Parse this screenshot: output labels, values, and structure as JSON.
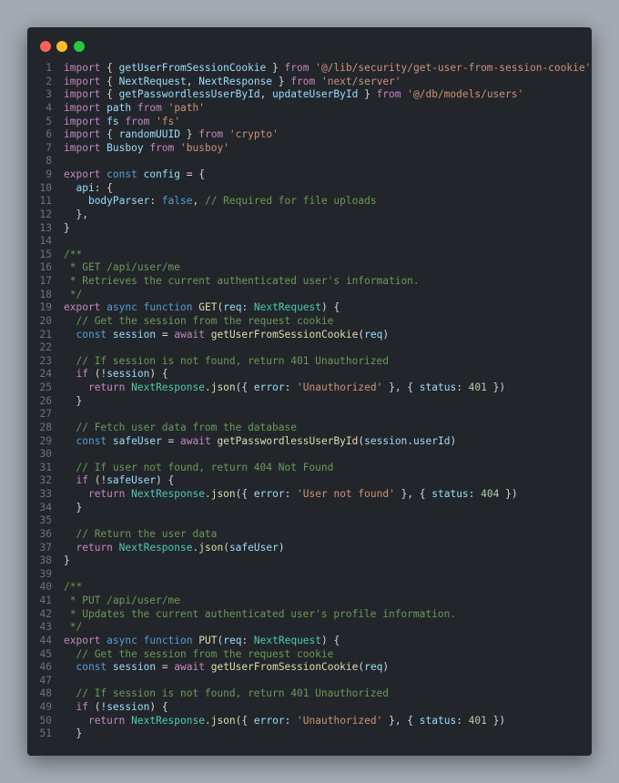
{
  "window": {
    "controls": [
      "close",
      "minimize",
      "zoom"
    ]
  },
  "code": {
    "colors": {
      "keyword": "#569cd6",
      "control": "#c586c0",
      "string": "#ce9178",
      "comment": "#6a9955",
      "function": "#dcdcaa",
      "variable": "#9cdcfe",
      "number": "#b5cea8",
      "type": "#4ec9b0",
      "text": "#d4d4d4"
    },
    "lines": [
      {
        "n": "1",
        "t": [
          [
            "ctl",
            "import"
          ],
          [
            "txt",
            " { "
          ],
          [
            "var",
            "getUserFromSessionCookie"
          ],
          [
            "txt",
            " } "
          ],
          [
            "ctl",
            "from"
          ],
          [
            "txt",
            " "
          ],
          [
            "str",
            "'@/lib/security/get-user-from-session-cookie'"
          ]
        ]
      },
      {
        "n": "2",
        "t": [
          [
            "ctl",
            "import"
          ],
          [
            "txt",
            " { "
          ],
          [
            "var",
            "NextRequest"
          ],
          [
            "txt",
            ", "
          ],
          [
            "var",
            "NextResponse"
          ],
          [
            "txt",
            " } "
          ],
          [
            "ctl",
            "from"
          ],
          [
            "txt",
            " "
          ],
          [
            "str",
            "'next/server'"
          ]
        ]
      },
      {
        "n": "3",
        "t": [
          [
            "ctl",
            "import"
          ],
          [
            "txt",
            " { "
          ],
          [
            "var",
            "getPasswordlessUserById"
          ],
          [
            "txt",
            ", "
          ],
          [
            "var",
            "updateUserById"
          ],
          [
            "txt",
            " } "
          ],
          [
            "ctl",
            "from"
          ],
          [
            "txt",
            " "
          ],
          [
            "str",
            "'@/db/models/users'"
          ]
        ]
      },
      {
        "n": "4",
        "t": [
          [
            "ctl",
            "import"
          ],
          [
            "txt",
            " "
          ],
          [
            "var",
            "path"
          ],
          [
            "txt",
            " "
          ],
          [
            "ctl",
            "from"
          ],
          [
            "txt",
            " "
          ],
          [
            "str",
            "'path'"
          ]
        ]
      },
      {
        "n": "5",
        "t": [
          [
            "ctl",
            "import"
          ],
          [
            "txt",
            " "
          ],
          [
            "var",
            "fs"
          ],
          [
            "txt",
            " "
          ],
          [
            "ctl",
            "from"
          ],
          [
            "txt",
            " "
          ],
          [
            "str",
            "'fs'"
          ]
        ]
      },
      {
        "n": "6",
        "t": [
          [
            "ctl",
            "import"
          ],
          [
            "txt",
            " { "
          ],
          [
            "var",
            "randomUUID"
          ],
          [
            "txt",
            " } "
          ],
          [
            "ctl",
            "from"
          ],
          [
            "txt",
            " "
          ],
          [
            "str",
            "'crypto'"
          ]
        ]
      },
      {
        "n": "7",
        "t": [
          [
            "ctl",
            "import"
          ],
          [
            "txt",
            " "
          ],
          [
            "var",
            "Busboy"
          ],
          [
            "txt",
            " "
          ],
          [
            "ctl",
            "from"
          ],
          [
            "txt",
            " "
          ],
          [
            "str",
            "'busboy'"
          ]
        ]
      },
      {
        "n": "8",
        "t": []
      },
      {
        "n": "9",
        "t": [
          [
            "ctl",
            "export"
          ],
          [
            "txt",
            " "
          ],
          [
            "kw",
            "const"
          ],
          [
            "txt",
            " "
          ],
          [
            "var",
            "config"
          ],
          [
            "txt",
            " = {"
          ]
        ]
      },
      {
        "n": "10",
        "t": [
          [
            "txt",
            "  "
          ],
          [
            "var",
            "api"
          ],
          [
            "txt",
            ": {"
          ]
        ]
      },
      {
        "n": "11",
        "t": [
          [
            "txt",
            "    "
          ],
          [
            "var",
            "bodyParser"
          ],
          [
            "txt",
            ": "
          ],
          [
            "kw",
            "false"
          ],
          [
            "txt",
            ", "
          ],
          [
            "com",
            "// Required for file uploads"
          ]
        ]
      },
      {
        "n": "12",
        "t": [
          [
            "txt",
            "  },"
          ]
        ]
      },
      {
        "n": "13",
        "t": [
          [
            "txt",
            "}"
          ]
        ]
      },
      {
        "n": "14",
        "t": []
      },
      {
        "n": "15",
        "t": [
          [
            "com",
            "/**"
          ]
        ]
      },
      {
        "n": "16",
        "t": [
          [
            "com",
            " * GET /api/user/me"
          ]
        ]
      },
      {
        "n": "17",
        "t": [
          [
            "com",
            " * Retrieves the current authenticated user's information."
          ]
        ]
      },
      {
        "n": "18",
        "t": [
          [
            "com",
            " */"
          ]
        ]
      },
      {
        "n": "19",
        "t": [
          [
            "ctl",
            "export"
          ],
          [
            "txt",
            " "
          ],
          [
            "kw",
            "async"
          ],
          [
            "txt",
            " "
          ],
          [
            "kw",
            "function"
          ],
          [
            "txt",
            " "
          ],
          [
            "fn",
            "GET"
          ],
          [
            "txt",
            "("
          ],
          [
            "var",
            "req"
          ],
          [
            "txt",
            ": "
          ],
          [
            "typ",
            "NextRequest"
          ],
          [
            "txt",
            ") {"
          ]
        ]
      },
      {
        "n": "20",
        "t": [
          [
            "txt",
            "  "
          ],
          [
            "com",
            "// Get the session from the request cookie"
          ]
        ]
      },
      {
        "n": "21",
        "t": [
          [
            "txt",
            "  "
          ],
          [
            "kw",
            "const"
          ],
          [
            "txt",
            " "
          ],
          [
            "var",
            "session"
          ],
          [
            "txt",
            " = "
          ],
          [
            "ctl",
            "await"
          ],
          [
            "txt",
            " "
          ],
          [
            "fn",
            "getUserFromSessionCookie"
          ],
          [
            "txt",
            "("
          ],
          [
            "var",
            "req"
          ],
          [
            "txt",
            ")"
          ]
        ]
      },
      {
        "n": "22",
        "t": []
      },
      {
        "n": "23",
        "t": [
          [
            "txt",
            "  "
          ],
          [
            "com",
            "// If session is not found, return 401 Unauthorized"
          ]
        ]
      },
      {
        "n": "24",
        "t": [
          [
            "txt",
            "  "
          ],
          [
            "ctl",
            "if"
          ],
          [
            "txt",
            " (!"
          ],
          [
            "var",
            "session"
          ],
          [
            "txt",
            ") {"
          ]
        ]
      },
      {
        "n": "25",
        "t": [
          [
            "txt",
            "    "
          ],
          [
            "ctl",
            "return"
          ],
          [
            "txt",
            " "
          ],
          [
            "typ",
            "NextResponse"
          ],
          [
            "txt",
            "."
          ],
          [
            "fn",
            "json"
          ],
          [
            "txt",
            "({ "
          ],
          [
            "var",
            "error"
          ],
          [
            "txt",
            ": "
          ],
          [
            "str",
            "'Unauthorized'"
          ],
          [
            "txt",
            " }, { "
          ],
          [
            "var",
            "status"
          ],
          [
            "txt",
            ": "
          ],
          [
            "num",
            "401"
          ],
          [
            "txt",
            " })"
          ]
        ]
      },
      {
        "n": "26",
        "t": [
          [
            "txt",
            "  }"
          ]
        ]
      },
      {
        "n": "27",
        "t": []
      },
      {
        "n": "28",
        "t": [
          [
            "txt",
            "  "
          ],
          [
            "com",
            "// Fetch user data from the database"
          ]
        ]
      },
      {
        "n": "29",
        "t": [
          [
            "txt",
            "  "
          ],
          [
            "kw",
            "const"
          ],
          [
            "txt",
            " "
          ],
          [
            "var",
            "safeUser"
          ],
          [
            "txt",
            " = "
          ],
          [
            "ctl",
            "await"
          ],
          [
            "txt",
            " "
          ],
          [
            "fn",
            "getPasswordlessUserById"
          ],
          [
            "txt",
            "("
          ],
          [
            "var",
            "session"
          ],
          [
            "txt",
            "."
          ],
          [
            "var",
            "userId"
          ],
          [
            "txt",
            ")"
          ]
        ]
      },
      {
        "n": "30",
        "t": []
      },
      {
        "n": "31",
        "t": [
          [
            "txt",
            "  "
          ],
          [
            "com",
            "// If user not found, return 404 Not Found"
          ]
        ]
      },
      {
        "n": "32",
        "t": [
          [
            "txt",
            "  "
          ],
          [
            "ctl",
            "if"
          ],
          [
            "txt",
            " (!"
          ],
          [
            "var",
            "safeUser"
          ],
          [
            "txt",
            ") {"
          ]
        ]
      },
      {
        "n": "33",
        "t": [
          [
            "txt",
            "    "
          ],
          [
            "ctl",
            "return"
          ],
          [
            "txt",
            " "
          ],
          [
            "typ",
            "NextResponse"
          ],
          [
            "txt",
            "."
          ],
          [
            "fn",
            "json"
          ],
          [
            "txt",
            "({ "
          ],
          [
            "var",
            "error"
          ],
          [
            "txt",
            ": "
          ],
          [
            "str",
            "'User not found'"
          ],
          [
            "txt",
            " }, { "
          ],
          [
            "var",
            "status"
          ],
          [
            "txt",
            ": "
          ],
          [
            "num",
            "404"
          ],
          [
            "txt",
            " })"
          ]
        ]
      },
      {
        "n": "34",
        "t": [
          [
            "txt",
            "  }"
          ]
        ]
      },
      {
        "n": "35",
        "t": []
      },
      {
        "n": "36",
        "t": [
          [
            "txt",
            "  "
          ],
          [
            "com",
            "// Return the user data"
          ]
        ]
      },
      {
        "n": "37",
        "t": [
          [
            "txt",
            "  "
          ],
          [
            "ctl",
            "return"
          ],
          [
            "txt",
            " "
          ],
          [
            "typ",
            "NextResponse"
          ],
          [
            "txt",
            "."
          ],
          [
            "fn",
            "json"
          ],
          [
            "txt",
            "("
          ],
          [
            "var",
            "safeUser"
          ],
          [
            "txt",
            ")"
          ]
        ]
      },
      {
        "n": "38",
        "t": [
          [
            "txt",
            "}"
          ]
        ]
      },
      {
        "n": "39",
        "t": []
      },
      {
        "n": "40",
        "t": [
          [
            "com",
            "/**"
          ]
        ]
      },
      {
        "n": "41",
        "t": [
          [
            "com",
            " * PUT /api/user/me"
          ]
        ]
      },
      {
        "n": "42",
        "t": [
          [
            "com",
            " * Updates the current authenticated user's profile information."
          ]
        ]
      },
      {
        "n": "43",
        "t": [
          [
            "com",
            " */"
          ]
        ]
      },
      {
        "n": "44",
        "t": [
          [
            "ctl",
            "export"
          ],
          [
            "txt",
            " "
          ],
          [
            "kw",
            "async"
          ],
          [
            "txt",
            " "
          ],
          [
            "kw",
            "function"
          ],
          [
            "txt",
            " "
          ],
          [
            "fn",
            "PUT"
          ],
          [
            "txt",
            "("
          ],
          [
            "var",
            "req"
          ],
          [
            "txt",
            ": "
          ],
          [
            "typ",
            "NextRequest"
          ],
          [
            "txt",
            ") {"
          ]
        ]
      },
      {
        "n": "45",
        "t": [
          [
            "txt",
            "  "
          ],
          [
            "com",
            "// Get the session from the request cookie"
          ]
        ]
      },
      {
        "n": "46",
        "t": [
          [
            "txt",
            "  "
          ],
          [
            "kw",
            "const"
          ],
          [
            "txt",
            " "
          ],
          [
            "var",
            "session"
          ],
          [
            "txt",
            " = "
          ],
          [
            "ctl",
            "await"
          ],
          [
            "txt",
            " "
          ],
          [
            "fn",
            "getUserFromSessionCookie"
          ],
          [
            "txt",
            "("
          ],
          [
            "var",
            "req"
          ],
          [
            "txt",
            ")"
          ]
        ]
      },
      {
        "n": "47",
        "t": []
      },
      {
        "n": "48",
        "t": [
          [
            "txt",
            "  "
          ],
          [
            "com",
            "// If session is not found, return 401 Unauthorized"
          ]
        ]
      },
      {
        "n": "49",
        "t": [
          [
            "txt",
            "  "
          ],
          [
            "ctl",
            "if"
          ],
          [
            "txt",
            " (!"
          ],
          [
            "var",
            "session"
          ],
          [
            "txt",
            ") {"
          ]
        ]
      },
      {
        "n": "50",
        "t": [
          [
            "txt",
            "    "
          ],
          [
            "ctl",
            "return"
          ],
          [
            "txt",
            " "
          ],
          [
            "typ",
            "NextResponse"
          ],
          [
            "txt",
            "."
          ],
          [
            "fn",
            "json"
          ],
          [
            "txt",
            "({ "
          ],
          [
            "var",
            "error"
          ],
          [
            "txt",
            ": "
          ],
          [
            "str",
            "'Unauthorized'"
          ],
          [
            "txt",
            " }, { "
          ],
          [
            "var",
            "status"
          ],
          [
            "txt",
            ": "
          ],
          [
            "num",
            "401"
          ],
          [
            "txt",
            " })"
          ]
        ]
      },
      {
        "n": "51",
        "t": [
          [
            "txt",
            "  }"
          ]
        ]
      }
    ]
  }
}
